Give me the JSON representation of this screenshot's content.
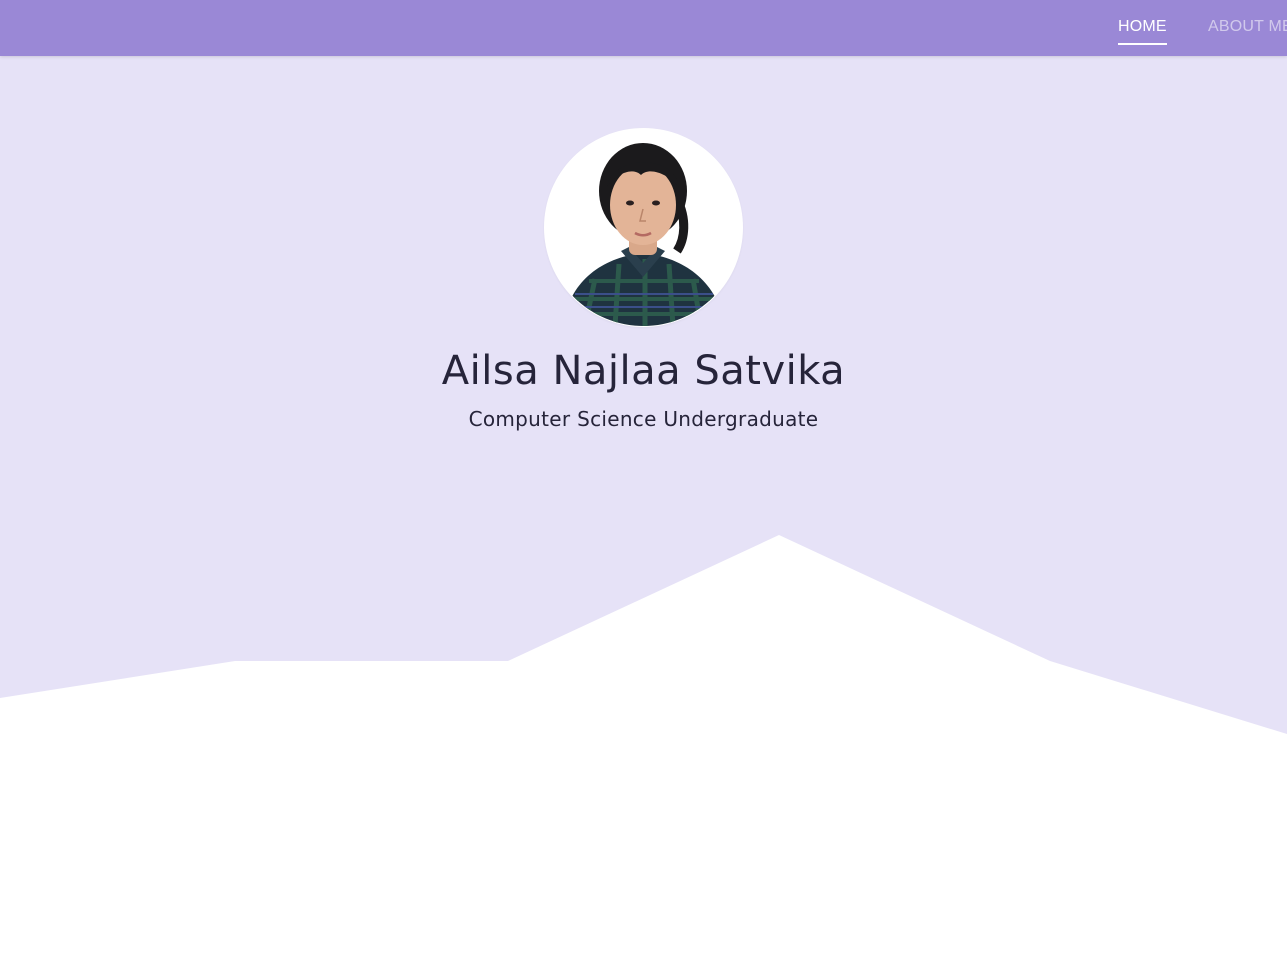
{
  "nav": {
    "items": [
      {
        "label": "HOME",
        "active": true
      },
      {
        "label": "ABOUT ME",
        "active": false
      }
    ]
  },
  "hero": {
    "name": "Ailsa Najlaa Satvika",
    "role": "Computer Science Undergraduate",
    "avatar_icon": "profile-photo"
  },
  "colors": {
    "navbar": "#9a88d6",
    "hero_background": "#e6e2f7",
    "text": "#26243a",
    "page_background": "#ffffff"
  }
}
